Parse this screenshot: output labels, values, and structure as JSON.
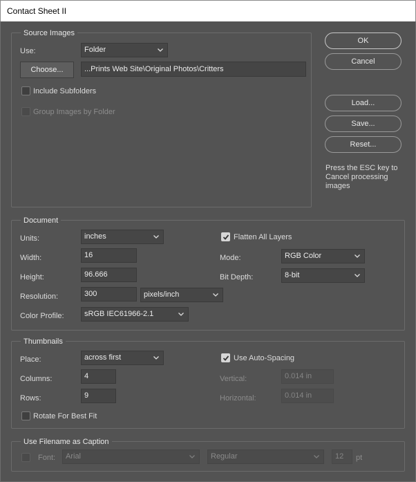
{
  "window": {
    "title": "Contact Sheet II"
  },
  "buttons": {
    "ok": "OK",
    "cancel": "Cancel",
    "load": "Load...",
    "save": "Save...",
    "reset": "Reset..."
  },
  "hint": [
    "Press the ESC key to",
    "Cancel processing",
    "images"
  ],
  "source_images": {
    "legend": "Source Images",
    "use_label": "Use:",
    "use_value": "Folder",
    "choose_label": "Choose...",
    "path_value": "...Prints Web Site\\Original Photos\\Critters",
    "include_subfolders_label": "Include Subfolders",
    "include_subfolders_checked": false,
    "group_by_folder_label": "Group Images by Folder",
    "group_by_folder_enabled": false
  },
  "document": {
    "legend": "Document",
    "units_label": "Units:",
    "units_value": "inches",
    "width_label": "Width:",
    "width_value": "16",
    "height_label": "Height:",
    "height_value": "96.666",
    "resolution_label": "Resolution:",
    "resolution_value": "300",
    "resolution_unit": "pixels/inch",
    "color_profile_label": "Color Profile:",
    "color_profile_value": "sRGB IEC61966-2.1",
    "flatten_label": "Flatten All Layers",
    "flatten_checked": true,
    "mode_label": "Mode:",
    "mode_value": "RGB Color",
    "bit_depth_label": "Bit Depth:",
    "bit_depth_value": "8-bit"
  },
  "thumbnails": {
    "legend": "Thumbnails",
    "place_label": "Place:",
    "place_value": "across first",
    "columns_label": "Columns:",
    "columns_value": "4",
    "rows_label": "Rows:",
    "rows_value": "9",
    "rotate_label": "Rotate For Best Fit",
    "rotate_checked": false,
    "auto_spacing_label": "Use Auto-Spacing",
    "auto_spacing_checked": true,
    "vertical_label": "Vertical:",
    "vertical_value": "0.014 in",
    "horizontal_label": "Horizontal:",
    "horizontal_value": "0.014 in"
  },
  "caption": {
    "legend": "Use Filename as Caption",
    "enabled": false,
    "font_label": "Font:",
    "font_value": "Arial",
    "style_value": "Regular",
    "size_value": "12",
    "size_unit": "pt"
  },
  "colors": {
    "background": "#535353",
    "field": "#454545",
    "border": "#6b6b6b",
    "text": "#e6e6e6",
    "disabled_text": "#8c8c8c"
  },
  "icons": {
    "dropdown": "chevron-down-icon",
    "checkmark": "checkmark-icon"
  }
}
